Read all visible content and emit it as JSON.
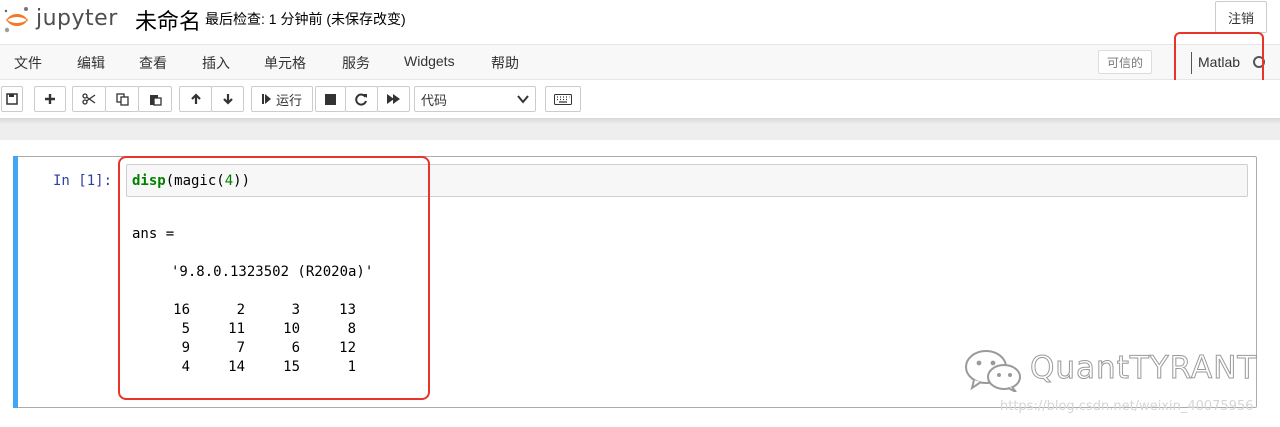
{
  "header": {
    "logo_text": "jupyter",
    "notebook_name": "未命名",
    "checkpoint_text": "最后检查: 1 分钟前  (未保存改变)",
    "logout_label": "注销"
  },
  "menubar": {
    "items": [
      {
        "label": "文件"
      },
      {
        "label": "编辑"
      },
      {
        "label": "查看"
      },
      {
        "label": "插入"
      },
      {
        "label": "单元格"
      },
      {
        "label": "服务"
      },
      {
        "label": "Widgets"
      },
      {
        "label": "帮助"
      }
    ],
    "trusted_label": "可信的",
    "kernel_name": "Matlab"
  },
  "toolbar": {
    "run_label": "运行",
    "cell_type_selected": "代码"
  },
  "cell": {
    "prompt": "In [1]:",
    "code_func": "disp",
    "code_open": "(magic(",
    "code_num": "4",
    "code_close": "))",
    "output": {
      "ans_line": "ans =",
      "version_line": "'9.8.0.1323502 (R2020a)'",
      "matrix": [
        [
          "16",
          "2",
          "3",
          "13"
        ],
        [
          "5",
          "11",
          "10",
          "8"
        ],
        [
          "9",
          "7",
          "6",
          "12"
        ],
        [
          "4",
          "14",
          "15",
          "1"
        ]
      ]
    }
  },
  "watermark": {
    "text": "QuantTYRANT",
    "url": "https://blog.csdn.net/weixin_40075956"
  },
  "colors": {
    "highlight": "#e8352a",
    "selected_cell_bar": "#42a5f5",
    "prompt": "#303f9f",
    "keyword": "#008000"
  }
}
